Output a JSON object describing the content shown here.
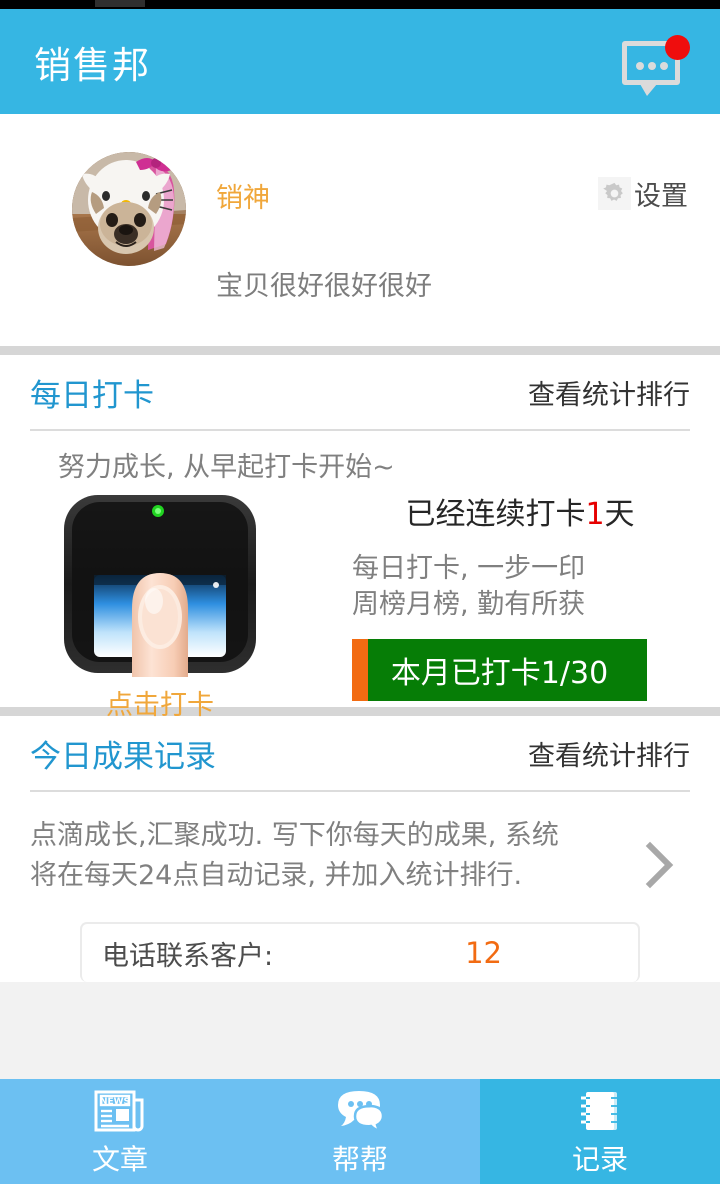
{
  "header": {
    "title": "销售邦",
    "message_icon": "message-bubble-icon",
    "badge": ""
  },
  "profile": {
    "nickname": "销神",
    "signature": "宝贝很好很好很好",
    "settings_label": "设置",
    "gear_icon": "gear-icon",
    "avatar_alt": "用户头像"
  },
  "checkin": {
    "section_title": "每日打卡",
    "section_link": "查看统计排行",
    "tip": "努力成长, 从早起打卡开始~",
    "fingerprint_label": "点击打卡",
    "streak_prefix": "已经连续打卡",
    "streak_days": "1",
    "streak_suffix": "天",
    "slogan_line1": "每日打卡, 一步一印",
    "slogan_line2": "周榜月榜, 勤有所获",
    "progress_text": "本月已打卡1/30",
    "progress_current": 1,
    "progress_total": 30,
    "progress_bar_color": "#067d06",
    "progress_done_color": "#f26b12"
  },
  "record": {
    "section_title": "今日成果记录",
    "section_link": "查看统计排行",
    "description_line1": "点滴成长,汇聚成功. 写下你每天的成果, 系统",
    "description_line2": "将在每天24点自动记录, 并加入统计排行.",
    "chevron_icon": "chevron-right-icon",
    "stats": [
      {
        "label": "电话联系客户:",
        "value": "12"
      }
    ]
  },
  "tabbar": {
    "items": [
      {
        "label": "文章",
        "icon": "newspaper-icon",
        "active": false
      },
      {
        "label": "帮帮",
        "icon": "chat-bubbles-icon",
        "active": false
      },
      {
        "label": "记录",
        "icon": "notebook-icon",
        "active": true
      }
    ]
  },
  "colors": {
    "brand_blue": "#36b6e3",
    "tab_blue": "#6cc0f2",
    "accent_orange": "#f0a73b",
    "value_orange": "#f26b12",
    "title_blue": "#2196cf",
    "red": "#e60000"
  }
}
